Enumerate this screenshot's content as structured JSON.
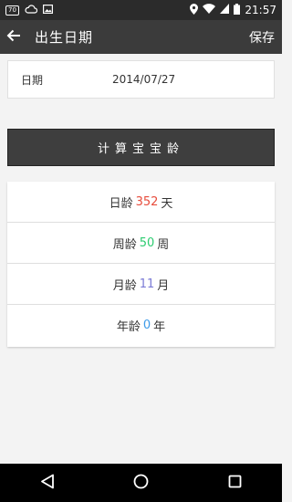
{
  "status_bar": {
    "badge": "70",
    "time": "21:57",
    "icons": [
      "signal-badge-icon",
      "cloud-icon",
      "image-icon",
      "location-icon",
      "wifi-icon",
      "cell-signal-icon",
      "battery-icon"
    ]
  },
  "app_bar": {
    "title": "出生日期",
    "save_label": "保存",
    "back_icon": "arrow-back-icon"
  },
  "date_field": {
    "label": "日期",
    "value": "2014/07/27"
  },
  "calculate_button": {
    "label": "计算宝宝龄"
  },
  "results": [
    {
      "prefix": "日龄",
      "value": "352",
      "unit": "天",
      "color": "#e74c3c"
    },
    {
      "prefix": "周龄",
      "value": "50",
      "unit": "周",
      "color": "#2ecc71"
    },
    {
      "prefix": "月龄",
      "value": "11",
      "unit": "月",
      "color": "#7b7bd6"
    },
    {
      "prefix": "年龄",
      "value": "0",
      "unit": "年",
      "color": "#3d9be9"
    }
  ],
  "nav_bar": {
    "icons": [
      "back-triangle-icon",
      "home-circle-icon",
      "recents-square-icon"
    ]
  },
  "colors": {
    "status_bar": "#2b2b2b",
    "app_bar": "#3b3b3b",
    "button": "#3e3e3e",
    "background": "#f3f3f3"
  }
}
